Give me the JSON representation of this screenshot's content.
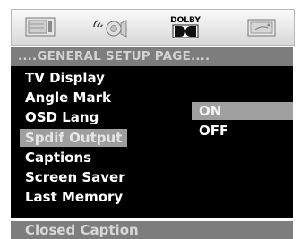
{
  "tabs": [
    {
      "icon": "general-setup-icon"
    },
    {
      "icon": "speaker-setup-icon"
    },
    {
      "icon": "dolby-digital-icon",
      "label": "DOLBY"
    },
    {
      "icon": "preference-icon"
    }
  ],
  "header": {
    "title": "....GENERAL SETUP PAGE...."
  },
  "menu": {
    "items": [
      {
        "label": "TV Display"
      },
      {
        "label": "Angle Mark"
      },
      {
        "label": "OSD Lang"
      },
      {
        "label": "Spdif Output"
      },
      {
        "label": "Captions"
      },
      {
        "label": "Screen Saver"
      },
      {
        "label": "Last Memory"
      }
    ],
    "selected_index": 3
  },
  "options": {
    "items": [
      {
        "label": "ON"
      },
      {
        "label": "OFF"
      }
    ],
    "highlighted_index": 0
  },
  "footer": {
    "text": "Closed Caption"
  },
  "colors": {
    "panel": "#000000",
    "header": "#7d7d7d",
    "highlight": "#a0a0a0"
  }
}
